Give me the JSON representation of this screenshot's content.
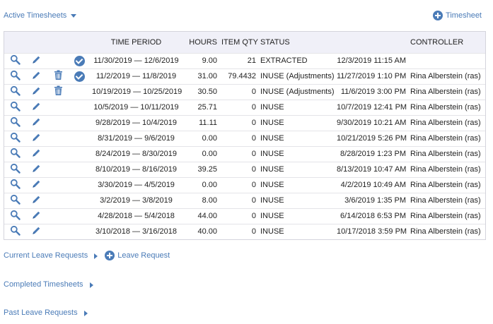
{
  "header": {
    "active_label": "Active Timesheets",
    "add_timesheet_label": "Timesheet"
  },
  "table": {
    "columns": [
      "TIME PERIOD",
      "HOURS",
      "ITEM QTY",
      "STATUS",
      "CONTROLLER"
    ],
    "rows": [
      {
        "view": true,
        "edit": true,
        "delete": false,
        "checked": true,
        "period": "11/30/2019 — 12/6/2019",
        "hours": "9.00",
        "qty": "21",
        "status": "EXTRACTED",
        "date": "12/3/2019 11:15 AM",
        "controller": ""
      },
      {
        "view": true,
        "edit": true,
        "delete": true,
        "checked": true,
        "period": "11/2/2019 — 11/8/2019",
        "hours": "31.00",
        "qty": "79.4432",
        "status": "INUSE (Adjustments)",
        "date": "11/27/2019 1:10 PM",
        "controller": "Rina Alberstein (ras)"
      },
      {
        "view": true,
        "edit": true,
        "delete": true,
        "checked": false,
        "period": "10/19/2019 — 10/25/2019",
        "hours": "30.50",
        "qty": "0",
        "status": "INUSE (Adjustments)",
        "date": "11/6/2019 3:00 PM",
        "controller": "Rina Alberstein (ras)"
      },
      {
        "view": true,
        "edit": true,
        "delete": false,
        "checked": false,
        "period": "10/5/2019 — 10/11/2019",
        "hours": "25.71",
        "qty": "0",
        "status": "INUSE",
        "date": "10/7/2019 12:41 PM",
        "controller": "Rina Alberstein (ras)"
      },
      {
        "view": true,
        "edit": true,
        "delete": false,
        "checked": false,
        "period": "9/28/2019 — 10/4/2019",
        "hours": "11.11",
        "qty": "0",
        "status": "INUSE",
        "date": "9/30/2019 10:21 AM",
        "controller": "Rina Alberstein (ras)"
      },
      {
        "view": true,
        "edit": true,
        "delete": false,
        "checked": false,
        "period": "8/31/2019 — 9/6/2019",
        "hours": "0.00",
        "qty": "0",
        "status": "INUSE",
        "date": "10/21/2019 5:26 PM",
        "controller": "Rina Alberstein (ras)"
      },
      {
        "view": true,
        "edit": true,
        "delete": false,
        "checked": false,
        "period": "8/24/2019 — 8/30/2019",
        "hours": "0.00",
        "qty": "0",
        "status": "INUSE",
        "date": "8/28/2019 1:23 PM",
        "controller": "Rina Alberstein (ras)"
      },
      {
        "view": true,
        "edit": true,
        "delete": false,
        "checked": false,
        "period": "8/10/2019 — 8/16/2019",
        "hours": "39.25",
        "qty": "0",
        "status": "INUSE",
        "date": "8/13/2019 10:47 AM",
        "controller": "Rina Alberstein (ras)"
      },
      {
        "view": true,
        "edit": true,
        "delete": false,
        "checked": false,
        "period": "3/30/2019 — 4/5/2019",
        "hours": "0.00",
        "qty": "0",
        "status": "INUSE",
        "date": "4/2/2019 10:49 AM",
        "controller": "Rina Alberstein (ras)"
      },
      {
        "view": true,
        "edit": true,
        "delete": false,
        "checked": false,
        "period": "3/2/2019 — 3/8/2019",
        "hours": "8.00",
        "qty": "0",
        "status": "INUSE",
        "date": "3/6/2019 1:35 PM",
        "controller": "Rina Alberstein (ras)"
      },
      {
        "view": true,
        "edit": true,
        "delete": false,
        "checked": false,
        "period": "4/28/2018 — 5/4/2018",
        "hours": "44.00",
        "qty": "0",
        "status": "INUSE",
        "date": "6/14/2018 6:53 PM",
        "controller": "Rina Alberstein (ras)"
      },
      {
        "view": true,
        "edit": true,
        "delete": false,
        "checked": false,
        "period": "3/10/2018 — 3/16/2018",
        "hours": "40.00",
        "qty": "0",
        "status": "INUSE",
        "date": "10/17/2018 3:59 PM",
        "controller": "Rina Alberstein (ras)"
      }
    ]
  },
  "sections": {
    "current_leave": "Current Leave Requests",
    "leave_request_add": "Leave Request",
    "completed": "Completed Timesheets",
    "past_leave": "Past Leave Requests"
  },
  "colors": {
    "accent": "#4a7bb7",
    "header_bg": "#f0f0f8"
  }
}
